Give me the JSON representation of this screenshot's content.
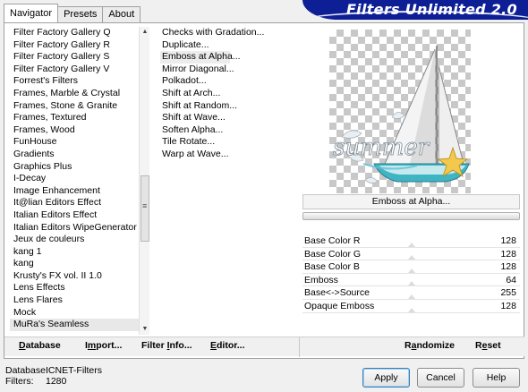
{
  "tabs": [
    {
      "label": "Navigator"
    },
    {
      "label": "Presets"
    },
    {
      "label": "About"
    }
  ],
  "banner_title": "Filters Unlimited 2.0",
  "categories": [
    "Filter Factory Gallery Q",
    "Filter Factory Gallery R",
    "Filter Factory Gallery S",
    "Filter Factory Gallery V",
    "Forrest's Filters",
    "Frames, Marble & Crystal",
    "Frames, Stone & Granite",
    "Frames, Textured",
    "Frames, Wood",
    "FunHouse",
    "Gradients",
    "Graphics Plus",
    "I-Decay",
    "Image Enhancement",
    "It@lian Editors Effect",
    "Italian Editors Effect",
    "Italian Editors WipeGenerator",
    "Jeux de couleurs",
    "kang 1",
    "kang",
    "Krusty's FX vol. II 1.0",
    "Lens Effects",
    "Lens Flares",
    "Mock",
    "MuRa's Seamless"
  ],
  "selected_category": "MuRa's Seamless",
  "filters": [
    "Checks with Gradation...",
    "Duplicate...",
    "Emboss at Alpha...",
    "Mirror Diagonal...",
    "Polkadot...",
    "Shift at Arch...",
    "Shift at Random...",
    "Shift at Wave...",
    "Soften Alpha...",
    "Tile Rotate...",
    "Warp at Wave..."
  ],
  "selected_filter": "Emboss at Alpha...",
  "preview": {
    "watermark_text": "summer"
  },
  "current_filter_name": "Emboss at Alpha...",
  "params": [
    {
      "name": "Base Color R",
      "value": "128"
    },
    {
      "name": "Base Color G",
      "value": "128"
    },
    {
      "name": "Base Color B",
      "value": "128"
    },
    {
      "name": "Emboss",
      "value": "64"
    },
    {
      "name": "Base<->Source",
      "value": "255"
    },
    {
      "name": "Opaque Emboss",
      "value": "128"
    }
  ],
  "toolbar": {
    "database": {
      "u": "D",
      "rest": "atabase"
    },
    "import": {
      "pre": "I",
      "u": "m",
      "rest": "port..."
    },
    "filter_info": {
      "pre": "Filter ",
      "u": "I",
      "rest": "nfo..."
    },
    "editor": {
      "u": "E",
      "rest": "ditor..."
    },
    "randomize": {
      "pre": "R",
      "u": "a",
      "rest": "ndomize"
    },
    "reset": {
      "pre": "R",
      "u": "e",
      "rest": "set"
    }
  },
  "status": {
    "database_label": "Database:",
    "database_value": "ICNET-Filters",
    "filters_label": "Filters:",
    "filters_value": "1280"
  },
  "buttons": {
    "apply": "Apply",
    "cancel": "Cancel",
    "help": "Help"
  },
  "colors": {
    "banner": "#0e1f96",
    "teal_accent": "#3fb5c4",
    "starfish": "#f2c94c"
  }
}
